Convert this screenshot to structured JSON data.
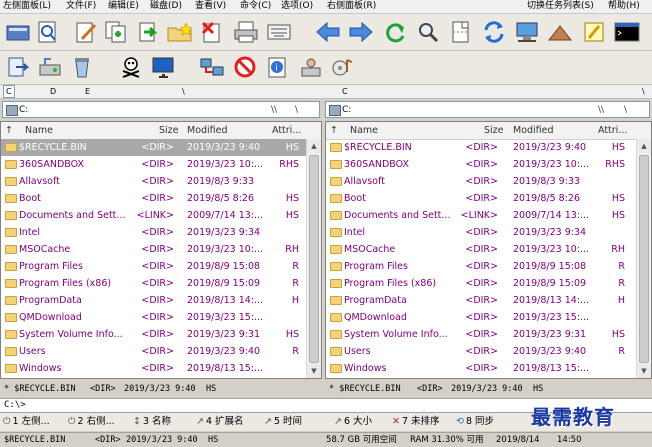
{
  "menu": {
    "left_panel": "左侧面板(L)",
    "file": "文件(F)",
    "edit": "编辑(E)",
    "disk": "磁盘(D)",
    "view": "查看(V)",
    "command": "命令(C)",
    "options": "选项(O)",
    "right_panel": "右侧面板(R)",
    "switch_task": "切换任务列表(S)",
    "help": "帮助(H)"
  },
  "drives": {
    "left": [
      "C",
      "D",
      "E",
      "\\"
    ],
    "right_c": "C",
    "right_root": "\\"
  },
  "left_panel": {
    "path": "C:",
    "path_buttons": [
      "\\\\",
      "\\"
    ],
    "headers": {
      "name": "Name",
      "size": "Size",
      "modified": "Modified",
      "attr": "Attri..."
    },
    "rows": [
      {
        "name": "$RECYCLE.BIN",
        "size": "<DIR>",
        "date": "2019/3/23  9:40",
        "attr": "HS"
      },
      {
        "name": "360SANDBOX",
        "size": "<DIR>",
        "date": "2019/3/23  10:...",
        "attr": "RHS"
      },
      {
        "name": "Allavsoft",
        "size": "<DIR>",
        "date": "2019/8/3  9:33",
        "attr": ""
      },
      {
        "name": "Boot",
        "size": "<DIR>",
        "date": "2019/8/5  8:26",
        "attr": "HS"
      },
      {
        "name": "Documents and Sett...",
        "size": "<LINK>",
        "date": "2009/7/14  13:...",
        "attr": "HS"
      },
      {
        "name": "Intel",
        "size": "<DIR>",
        "date": "2019/3/23  9:34",
        "attr": ""
      },
      {
        "name": "MSOCache",
        "size": "<DIR>",
        "date": "2019/3/23  10:...",
        "attr": "RH"
      },
      {
        "name": "Program Files",
        "size": "<DIR>",
        "date": "2019/8/9  15:08",
        "attr": "R"
      },
      {
        "name": "Program Files (x86)",
        "size": "<DIR>",
        "date": "2019/8/9  15:09",
        "attr": "R"
      },
      {
        "name": "ProgramData",
        "size": "<DIR>",
        "date": "2019/8/13  14:...",
        "attr": "H"
      },
      {
        "name": "QMDownload",
        "size": "<DIR>",
        "date": "2019/3/23  15:...",
        "attr": ""
      },
      {
        "name": "System Volume Info...",
        "size": "<DIR>",
        "date": "2019/3/23  9:31",
        "attr": "HS"
      },
      {
        "name": "Users",
        "size": "<DIR>",
        "date": "2019/3/23  9:40",
        "attr": "R"
      },
      {
        "name": "Windows",
        "size": "<DIR>",
        "date": "2019/8/13  15:...",
        "attr": ""
      }
    ],
    "info": {
      "name": "* $RECYCLE.BIN",
      "size": "<DIR>",
      "date": "2019/3/23  9:40",
      "attr": "HS"
    }
  },
  "right_panel": {
    "path": "C:",
    "path_buttons": [
      "\\\\",
      "\\"
    ],
    "headers": {
      "name": "Name",
      "size": "Size",
      "modified": "Modified",
      "attr": "Attri..."
    },
    "rows": [
      {
        "name": "$RECYCLE.BIN",
        "size": "<DIR>",
        "date": "2019/3/23  9:40",
        "attr": "HS"
      },
      {
        "name": "360SANDBOX",
        "size": "<DIR>",
        "date": "2019/3/23  10:...",
        "attr": "RHS"
      },
      {
        "name": "Allavsoft",
        "size": "<DIR>",
        "date": "2019/8/3  9:33",
        "attr": ""
      },
      {
        "name": "Boot",
        "size": "<DIR>",
        "date": "2019/8/5  8:26",
        "attr": "HS"
      },
      {
        "name": "Documents and Sett...",
        "size": "<LINK>",
        "date": "2009/7/14  13:...",
        "attr": "HS"
      },
      {
        "name": "Intel",
        "size": "<DIR>",
        "date": "2019/3/23  9:34",
        "attr": ""
      },
      {
        "name": "MSOCache",
        "size": "<DIR>",
        "date": "2019/3/23  10:...",
        "attr": "RH"
      },
      {
        "name": "Program Files",
        "size": "<DIR>",
        "date": "2019/8/9  15:08",
        "attr": "R"
      },
      {
        "name": "Program Files (x86)",
        "size": "<DIR>",
        "date": "2019/8/9  15:09",
        "attr": "R"
      },
      {
        "name": "ProgramData",
        "size": "<DIR>",
        "date": "2019/8/13  14:...",
        "attr": "H"
      },
      {
        "name": "QMDownload",
        "size": "<DIR>",
        "date": "2019/3/23  15:...",
        "attr": ""
      },
      {
        "name": "System Volume Info...",
        "size": "<DIR>",
        "date": "2019/3/23  9:31",
        "attr": "HS"
      },
      {
        "name": "Users",
        "size": "<DIR>",
        "date": "2019/3/23  9:40",
        "attr": "R"
      },
      {
        "name": "Windows",
        "size": "<DIR>",
        "date": "2019/8/13  15:...",
        "attr": ""
      }
    ],
    "info": {
      "name": "* $RECYCLE.BIN",
      "size": "<DIR>",
      "date": "2019/3/23  9:40",
      "attr": "HS"
    }
  },
  "command_line": "C:\\>",
  "fkeys": [
    {
      "key": "1",
      "label": "左侧..."
    },
    {
      "key": "2",
      "label": "右侧..."
    },
    {
      "key": "3",
      "label": "名称"
    },
    {
      "key": "4",
      "label": "扩展名"
    },
    {
      "key": "5",
      "label": "时间"
    },
    {
      "key": "6",
      "label": "大小"
    },
    {
      "key": "7",
      "label": "未排序"
    },
    {
      "key": "8",
      "label": "同步"
    }
  ],
  "status": {
    "file": "$RECYCLE.BIN",
    "size": "<DIR>",
    "date": "2019/3/23  9:40",
    "attr": "HS",
    "disk": "58.7 GB 可用空间",
    "ram": "RAM 31.30% 可用",
    "today": "2019/8/14",
    "time": "14:50"
  },
  "watermark": "最需教育",
  "toolbar_icons": [
    "toggle-panel-icon",
    "find-icon",
    "edit-icon",
    "copy-icon",
    "move-icon",
    "new-folder-icon",
    "delete-icon",
    "print-icon",
    "keyboard-icon",
    "back-icon",
    "forward-icon",
    "refresh-icon",
    "search-icon",
    "split-file-icon",
    "sync-icon",
    "network-icon",
    "pyramid-icon",
    "pencil-icon",
    "console-icon",
    "exit-icon",
    "disk-tools-icon",
    "recycle-bin-icon",
    "kill-icon",
    "monitor-icon",
    "network-share-icon",
    "block-icon",
    "info-icon",
    "user-icon",
    "media-icon"
  ],
  "colors": {
    "file_text": "#800080",
    "highlight_row": "#a9a9a9",
    "watermark": "#1a3aa0"
  }
}
